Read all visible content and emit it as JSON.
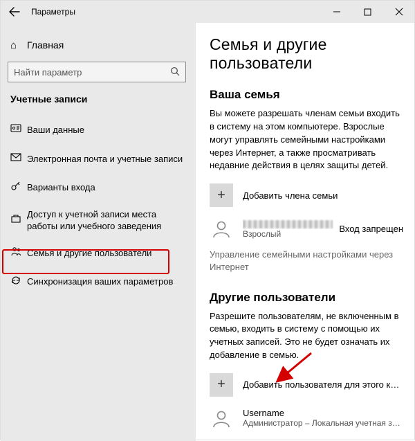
{
  "titlebar": {
    "title": "Параметры"
  },
  "sidebar": {
    "home": "Главная",
    "search_placeholder": "Найти параметр",
    "group": "Учетные записи",
    "items": [
      {
        "icon": "user-data-icon",
        "label": "Ваши данные"
      },
      {
        "icon": "mail-icon",
        "label": "Электронная почта и учетные записи"
      },
      {
        "icon": "key-icon",
        "label": "Варианты входа"
      },
      {
        "icon": "briefcase-icon",
        "label": "Доступ к учетной записи места работы или учебного заведения"
      },
      {
        "icon": "family-icon",
        "label": "Семья и другие пользователи"
      },
      {
        "icon": "sync-icon",
        "label": "Синхронизация ваших параметров"
      }
    ]
  },
  "main": {
    "heading": "Семья и другие пользователи",
    "family": {
      "title": "Ваша семья",
      "description": "Вы можете разрешать членам семьи входить в систему на этом компьютере. Взрослые могут управлять семейными настройками через Интернет, а также просматривать недавние действия в целях защиты детей.",
      "add_label": "Добавить члена семьи",
      "member": {
        "role": "Взрослый",
        "status": "Вход запрещен"
      },
      "manage_note": "Управление семейными настройками через Интернет"
    },
    "others": {
      "title": "Другие пользователи",
      "description": "Разрешите пользователям, не включенным в семью, входить в систему с помощью их учетных записей. Это не будет означать их добавление в семью.",
      "add_label": "Добавить пользователя для этого компь...",
      "user": {
        "name": "Username",
        "role": "Администратор – Локальная учетная зап..."
      }
    }
  }
}
